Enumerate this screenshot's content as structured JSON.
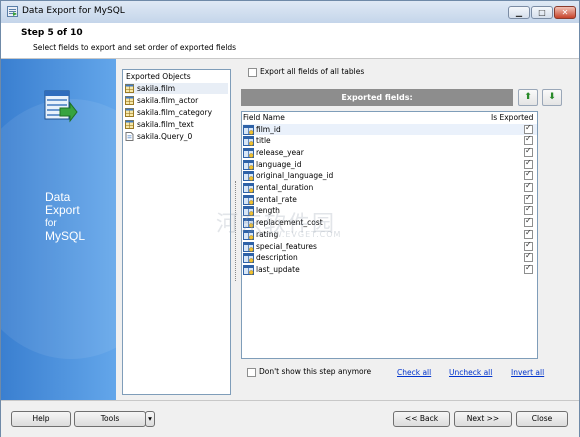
{
  "window": {
    "title": "Data Export for MySQL",
    "controls": {
      "minimize": "▁",
      "maximize": "□",
      "close": "✕"
    }
  },
  "header": {
    "step": "Step 5 of 10",
    "subtitle": "Select fields to export and set order of exported fields"
  },
  "sidebar": {
    "product_line1": "Data",
    "product_line2": "Export",
    "product_line3": "for",
    "product_line4": "MySQL"
  },
  "objects": {
    "header": "Exported Objects",
    "items": [
      {
        "label": "sakila.film",
        "icon": "table-icon",
        "selected": true
      },
      {
        "label": "sakila.film_actor",
        "icon": "table-icon",
        "selected": false
      },
      {
        "label": "sakila.film_category",
        "icon": "table-icon",
        "selected": false
      },
      {
        "label": "sakila.film_text",
        "icon": "table-icon",
        "selected": false
      },
      {
        "label": "sakila.Query_0",
        "icon": "query-icon",
        "selected": false
      }
    ]
  },
  "export_all": {
    "label": "Export all fields of all tables",
    "checked": false
  },
  "exported_fields": {
    "title": "Exported fields:",
    "up_button": "⬆",
    "down_button": "⬇",
    "columns": {
      "field_name": "Field Name",
      "is_exported": "Is Exported"
    },
    "rows": [
      {
        "name": "film_id",
        "exported": true
      },
      {
        "name": "title",
        "exported": true
      },
      {
        "name": "release_year",
        "exported": true
      },
      {
        "name": "language_id",
        "exported": true
      },
      {
        "name": "original_language_id",
        "exported": true
      },
      {
        "name": "rental_duration",
        "exported": true
      },
      {
        "name": "rental_rate",
        "exported": true
      },
      {
        "name": "length",
        "exported": true
      },
      {
        "name": "replacement_cost",
        "exported": true
      },
      {
        "name": "rating",
        "exported": true
      },
      {
        "name": "special_features",
        "exported": true
      },
      {
        "name": "description",
        "exported": true
      },
      {
        "name": "last_update",
        "exported": true
      }
    ]
  },
  "dont_show": {
    "label": "Don't show this step anymore",
    "checked": false
  },
  "links": {
    "check_all": "Check all",
    "uncheck_all": "Uncheck all",
    "invert_all": "Invert all"
  },
  "buttons": {
    "help": "Help",
    "tools": "Tools",
    "tools_dropdown": "▾",
    "back": "<< Back",
    "next": "Next >>",
    "close": "Close"
  },
  "watermark": {
    "text": "河东软件园",
    "url": "WWW.EVGET.COM"
  },
  "colors": {
    "accent": "#3a7fd0",
    "link": "#0033cc",
    "fields_bar": "#8d8d8d"
  }
}
